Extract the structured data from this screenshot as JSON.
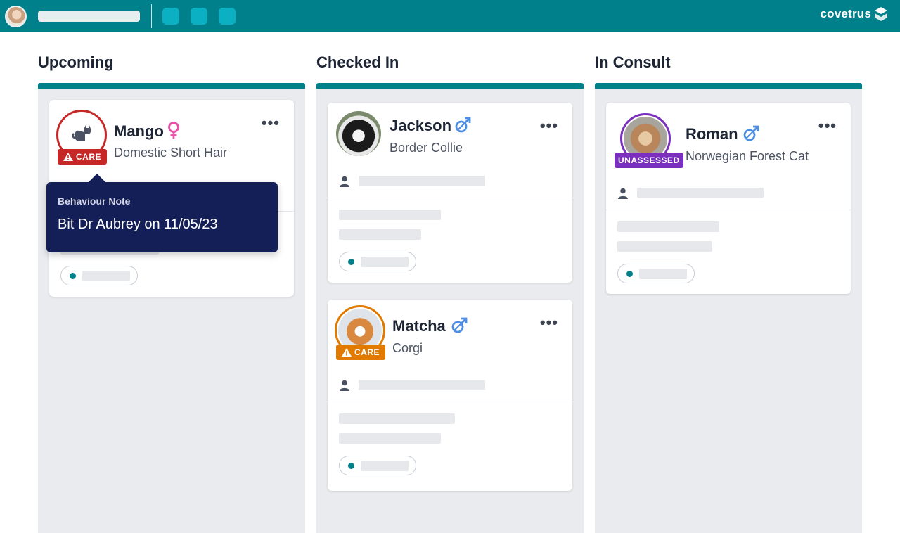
{
  "brand": {
    "name": "covetrus"
  },
  "colors": {
    "teal": "#00808a",
    "care_red": "#c62828",
    "care_orange": "#e07a00",
    "unassessed_purple": "#7b2fbe",
    "female_pink": "#e84fa6",
    "male_blue": "#4d8fe6",
    "tooltip_navy": "#141f57"
  },
  "topbar": {
    "icons": [
      "user-avatar",
      "placeholder-search",
      "app-icon-1",
      "app-icon-2",
      "app-icon-3",
      "covetrus-logo"
    ]
  },
  "columns": [
    {
      "title": "Upcoming",
      "cards": [
        {
          "name": "Mango",
          "breed": "Domestic Short Hair",
          "sex": "female",
          "sex_icon": "female-icon",
          "badge": "CARE",
          "badge_icon": "warning-icon",
          "photo": "cat-placeholder-icon",
          "menu": "•••"
        }
      ]
    },
    {
      "title": "Checked In",
      "cards": [
        {
          "name": "Jackson",
          "breed": "Border Collie",
          "sex": "male",
          "sex_icon": "male-neutered-icon",
          "badge": "",
          "photo": "dog-photo",
          "menu": "•••"
        },
        {
          "name": "Matcha",
          "breed": "Corgi",
          "sex": "male",
          "sex_icon": "male-neutered-icon",
          "badge": "CARE",
          "badge_icon": "warning-icon",
          "photo": "corgi-photo",
          "menu": "•••"
        }
      ]
    },
    {
      "title": "In Consult",
      "cards": [
        {
          "name": "Roman",
          "breed": "Norwegian Forest Cat",
          "sex": "male",
          "sex_icon": "male-neutered-icon",
          "badge": "UNASSESSED",
          "photo": "cat-photo",
          "menu": "•••"
        }
      ]
    }
  ],
  "tooltip": {
    "title": "Behaviour Note",
    "body": "Bit Dr Aubrey on 11/05/23"
  }
}
